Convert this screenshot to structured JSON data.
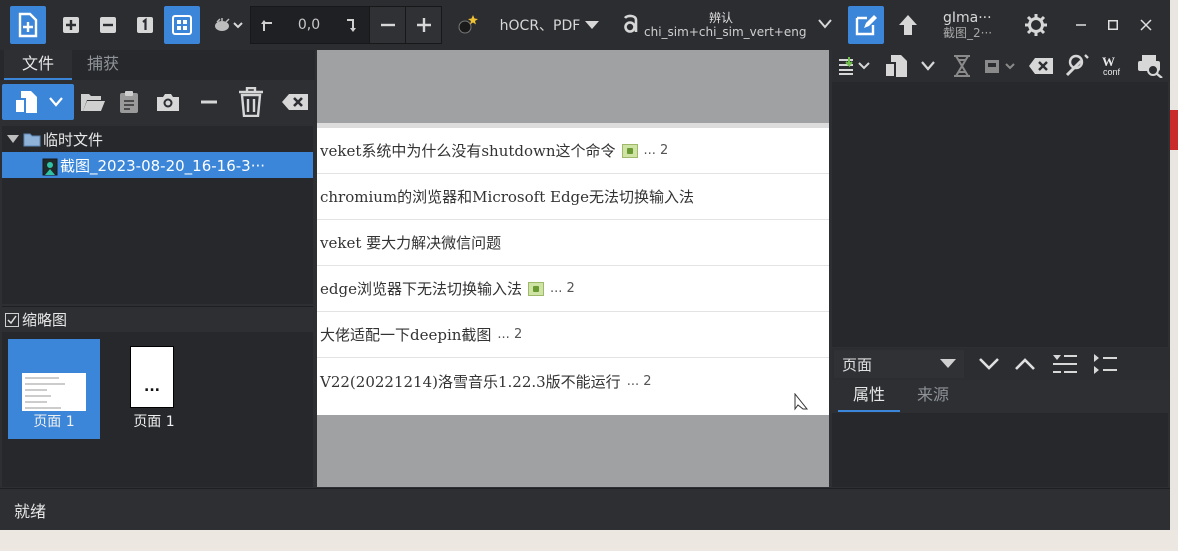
{
  "toolbar": {
    "output_format": "hOCR、PDF",
    "rotation_value": "0,0",
    "recognize_label": "辨认",
    "languages": "chi_sim+chi_sim_vert+eng",
    "gimage_title": "gIma···",
    "gimage_sub": "截图_2···"
  },
  "left": {
    "tabs": [
      "文件",
      "捕获"
    ],
    "tree": {
      "folder": "临时文件",
      "file": "截图_2023-08-20_16-16-3···"
    },
    "thumbnails_label": "缩略图",
    "thumbnails": [
      {
        "label": "页面 1"
      },
      {
        "label": "页面 1",
        "placeholder": "..."
      }
    ]
  },
  "document": {
    "rows": [
      {
        "text": "veket系统中为什么没有shutdown这个命令",
        "has_image": true,
        "count": "... 2"
      },
      {
        "text": "chromium的浏览器和Microsoft Edge无法切换输入法",
        "has_image": false,
        "count": ""
      },
      {
        "text": "veket 要大力解决微信问题",
        "has_image": false,
        "count": ""
      },
      {
        "text": "edge浏览器下无法切换输入法",
        "has_image": true,
        "count": "... 2"
      },
      {
        "text": "大佬适配一下deepin截图",
        "has_image": false,
        "count": "... 2"
      },
      {
        "text": "V22(20221214)洛雪音乐1.22.3版不能运行",
        "has_image": false,
        "count": "... 2"
      }
    ]
  },
  "right": {
    "nav_combo": "页面",
    "tabs": [
      "属性",
      "来源"
    ]
  },
  "status": "就绪",
  "colors": {
    "accent": "#3b86d8",
    "panel": "#2d2f33",
    "panel_dark": "#26282c"
  }
}
